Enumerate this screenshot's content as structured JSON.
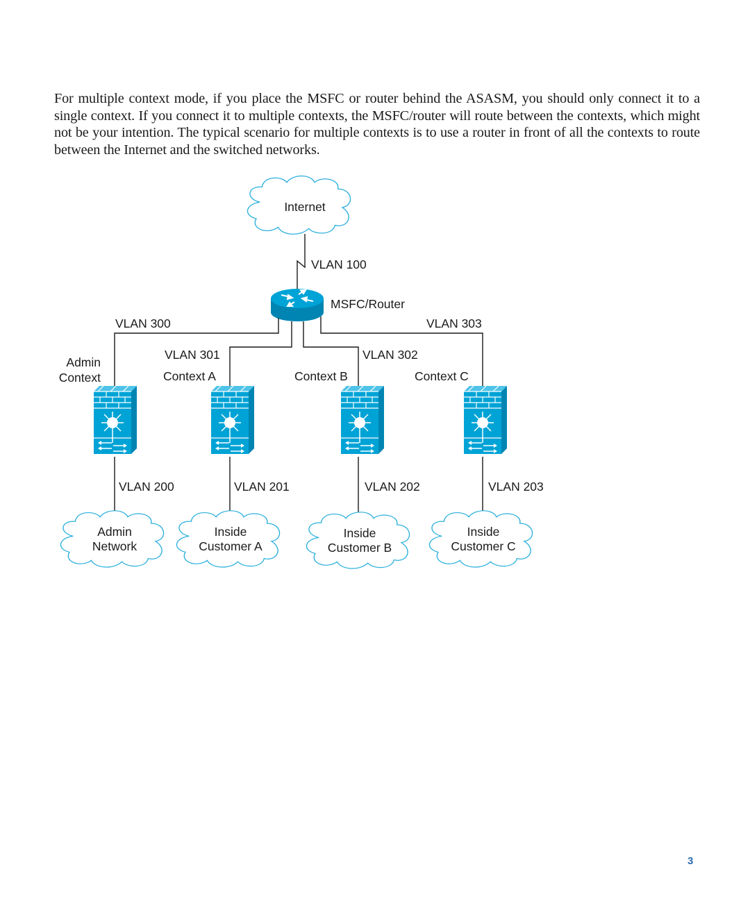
{
  "paragraph": "For multiple context mode, if you place the MSFC or router behind the ASASM, you should only connect it to a single context. If you connect it to multiple contexts, the MSFC/router will route between the contexts, which might not be your intention. The typical scenario for multiple contexts is to use a router in front of all the contexts to route between the Internet and the switched networks.",
  "diagram": {
    "internet": {
      "label": "Internet",
      "icon": "cloud-icon"
    },
    "uplink_vlan": "VLAN 100",
    "router": {
      "label": "MSFC/Router",
      "icon": "router-icon"
    },
    "contexts": [
      {
        "name_line1": "Admin",
        "name_line2": "Context",
        "outside_vlan": "VLAN 300",
        "inside_vlan": "VLAN 200",
        "network_line1": "Admin",
        "network_line2": "Network",
        "icon": "firewall-service-module-icon"
      },
      {
        "name_line1": "",
        "name_line2": "Context A",
        "outside_vlan": "VLAN 301",
        "inside_vlan": "VLAN 201",
        "network_line1": "Inside",
        "network_line2": "Customer A",
        "icon": "firewall-service-module-icon"
      },
      {
        "name_line1": "",
        "name_line2": "Context B",
        "outside_vlan": "VLAN 302",
        "inside_vlan": "VLAN 202",
        "network_line1": "Inside",
        "network_line2": "Customer B",
        "icon": "firewall-service-module-icon"
      },
      {
        "name_line1": "",
        "name_line2": "Context C",
        "outside_vlan": "VLAN 303",
        "inside_vlan": "VLAN 203",
        "network_line1": "Inside",
        "network_line2": "Customer C",
        "icon": "firewall-service-module-icon"
      }
    ],
    "colors": {
      "device_fill": "#00a3d6",
      "device_dark": "#0085b3",
      "cloud_stroke": "#2bb0dc",
      "line": "#1a1a1a"
    }
  },
  "page_number": "3"
}
